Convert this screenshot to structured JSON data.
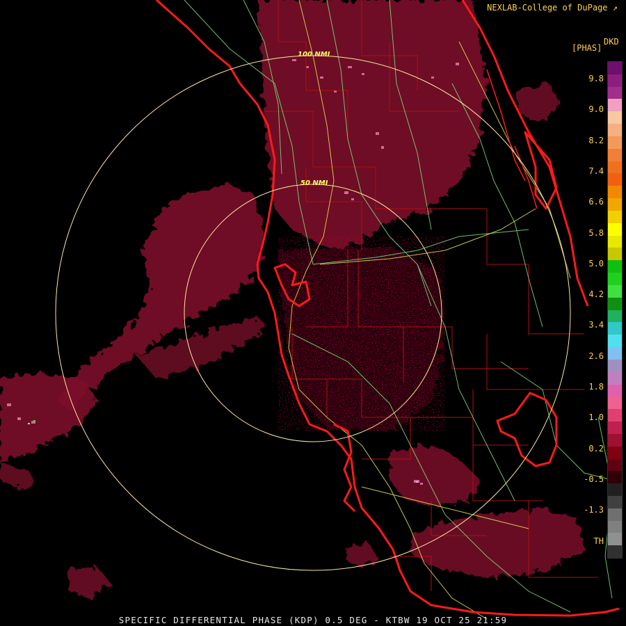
{
  "credit": "NEXLAB-College of DuPage",
  "credit_icon": "external-link-icon",
  "legend": {
    "title_units": "[PHAS]",
    "title_product": "DKD",
    "ticks": [
      "9.8",
      "9.0",
      "8.2",
      "7.4",
      "6.6",
      "5.8",
      "5.0",
      "4.2",
      "3.4",
      "2.6",
      "1.8",
      "1.0",
      "0.2",
      "-0.5",
      "-1.3",
      "TH"
    ],
    "colors": [
      "#6e0e6e",
      "#8e1e7e",
      "#a02e8a",
      "#f0a0c0",
      "#f8c8a0",
      "#f6b080",
      "#f39a58",
      "#f08038",
      "#f07020",
      "#f06010",
      "#f08800",
      "#f0a800",
      "#f0d000",
      "#ffff00",
      "#e8e800",
      "#c8c800",
      "#10c010",
      "#20d020",
      "#40e040",
      "#109010",
      "#20b060",
      "#30c8c8",
      "#50e0f0",
      "#80c0f0",
      "#a090c0",
      "#c080c0",
      "#e060b0",
      "#f06090",
      "#e04070",
      "#c02050",
      "#a01030",
      "#800010",
      "#600010",
      "#300008",
      "#202020",
      "#404040",
      "#707070",
      "#808080",
      "#909090",
      "#303030"
    ]
  },
  "rings": {
    "inner_label": "50 NMI",
    "outer_label": "100 NMI"
  },
  "footer": "SPECIFIC DIFFERENTIAL PHASE (KDP) 0.5 DEG - KTBW 19 OCT 25 21:59"
}
